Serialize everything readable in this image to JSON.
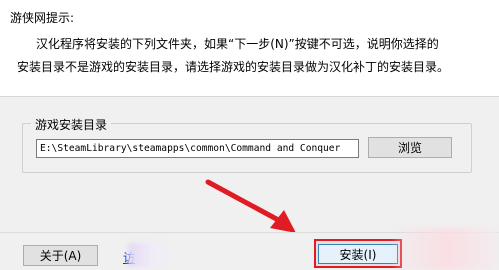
{
  "header": {
    "heading": "游侠网提示:",
    "line1": "汉化程序将安装的下列文件夹，如果“下一步(N)”按键不可选，说明你选择的",
    "line2": "安装目录不是游戏的安装目录，请选择游戏的安装目录做为汉化补丁的安装目录。"
  },
  "install_dir": {
    "group_label": "游戏安装目录",
    "path_value": "E:\\SteamLibrary\\steamapps\\common\\Command and Conquer",
    "browse_label": "浏览"
  },
  "footer": {
    "about_label": "关于(A)",
    "link_text": "访",
    "install_label": "安装(I)"
  },
  "colors": {
    "highlight": "#e11b24",
    "window_bg": "#f0f0f0"
  },
  "icons": [
    "red-arrow-icon"
  ]
}
